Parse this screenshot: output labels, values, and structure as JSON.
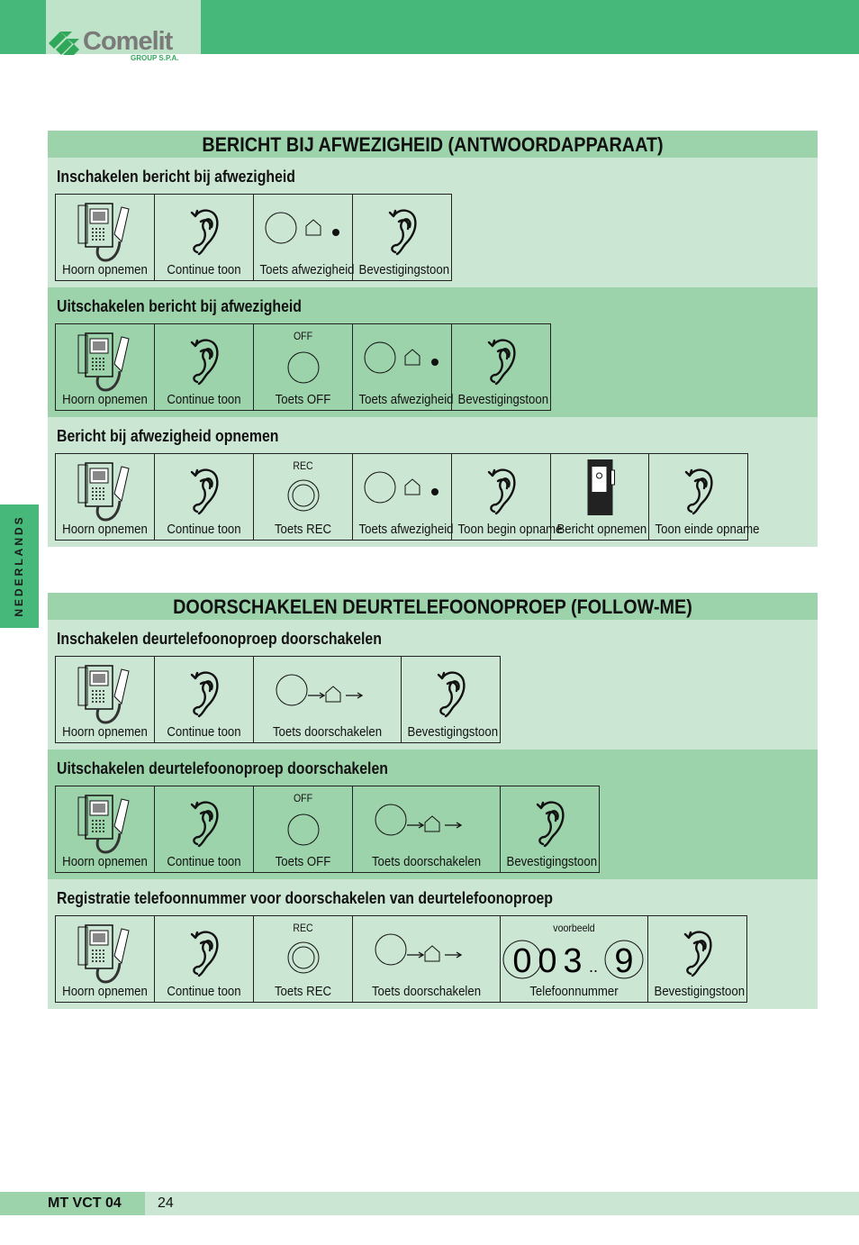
{
  "header": {
    "logo": "Comelit",
    "logo_sub": "GROUP S.P.A."
  },
  "side_tab": "NEDERLANDS",
  "sections": [
    {
      "title": "BERICHT BIJ AFWEZIGHEID (ANTWOORDAPPARAAT)",
      "blocks": [
        {
          "title": "Inschakelen bericht bij afwezigheid",
          "cells": [
            {
              "icon": "handset-icon",
              "label": "Hoorn opnemen"
            },
            {
              "icon": "ear-icon",
              "label": "Continue toon"
            },
            {
              "icon": "button-house-dot-icon",
              "label": "Toets afwezigheid"
            },
            {
              "icon": "ear-icon",
              "label": "Bevestigingstoon"
            }
          ]
        },
        {
          "title": "Uitschakelen bericht bij afwezigheid",
          "cells": [
            {
              "icon": "handset-icon",
              "label": "Hoorn opnemen"
            },
            {
              "icon": "ear-icon",
              "label": "Continue toon"
            },
            {
              "icon": "button-icon",
              "top": "OFF",
              "label": "Toets OFF"
            },
            {
              "icon": "button-house-dot-icon",
              "label": "Toets afwezigheid"
            },
            {
              "icon": "ear-icon",
              "label": "Bevestigingstoon"
            }
          ]
        },
        {
          "title": "Bericht bij afwezigheid opnemen",
          "cells": [
            {
              "icon": "handset-icon",
              "label": "Hoorn opnemen"
            },
            {
              "icon": "ear-icon",
              "label": "Continue toon"
            },
            {
              "icon": "rec-button-icon",
              "top": "REC",
              "label": "Toets REC"
            },
            {
              "icon": "button-house-dot-icon",
              "label": "Toets afwezigheid"
            },
            {
              "icon": "ear-icon",
              "label": "Toon begin opname"
            },
            {
              "icon": "recorder-icon",
              "label": "Bericht opnemen"
            },
            {
              "icon": "ear-icon",
              "label": "Toon einde opname"
            }
          ]
        }
      ]
    },
    {
      "title": "DOORSCHAKELEN DEURTELEFOONOPROEP (FOLLOW-ME)",
      "blocks": [
        {
          "title": "Inschakelen deurtelefoonoproep doorschakelen",
          "cells": [
            {
              "icon": "handset-icon",
              "label": "Hoorn opnemen"
            },
            {
              "icon": "ear-icon",
              "label": "Continue toon"
            },
            {
              "icon": "button-arrow-house-arrow-icon",
              "label": "Toets doorschakelen"
            },
            {
              "icon": "ear-icon",
              "label": "Bevestigingstoon"
            }
          ]
        },
        {
          "title": "Uitschakelen deurtelefoonoproep doorschakelen",
          "cells": [
            {
              "icon": "handset-icon",
              "label": "Hoorn opnemen"
            },
            {
              "icon": "ear-icon",
              "label": "Continue toon"
            },
            {
              "icon": "button-icon",
              "top": "OFF",
              "label": "Toets OFF"
            },
            {
              "icon": "button-arrow-house-arrow-icon",
              "label": "Toets doorschakelen"
            },
            {
              "icon": "ear-icon",
              "label": "Bevestigingstoon"
            }
          ]
        },
        {
          "title": "Registratie telefoonnummer voor doorschakelen van deurtelefoonoproep",
          "cells": [
            {
              "icon": "handset-icon",
              "label": "Hoorn opnemen"
            },
            {
              "icon": "ear-icon",
              "label": "Continue toon"
            },
            {
              "icon": "rec-button-icon",
              "top": "REC",
              "label": "Toets REC"
            },
            {
              "icon": "button-arrow-house-arrow-icon",
              "label": "Toets doorschakelen"
            },
            {
              "icon": "phone-number-icon",
              "top": "voorbeeld",
              "label": "Telefoonnummer",
              "digits": [
                "0",
                "0",
                "3",
                "..",
                "9"
              ]
            },
            {
              "icon": "ear-icon",
              "label": "Bevestigingstoon"
            }
          ]
        }
      ]
    }
  ],
  "footer": {
    "code": "MT VCT 04",
    "page": "24"
  }
}
